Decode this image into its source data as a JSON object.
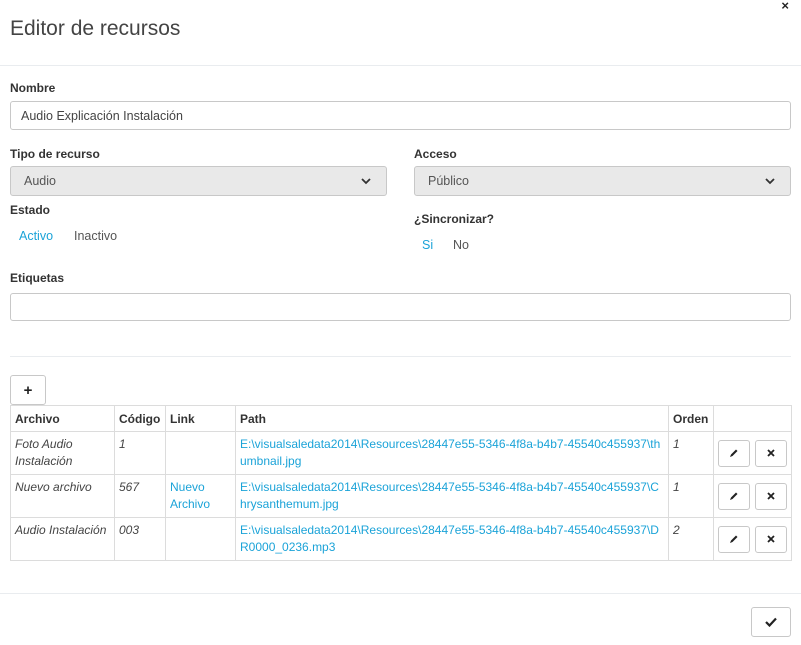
{
  "modal": {
    "title": "Editor de recursos",
    "close_icon": "close-icon"
  },
  "form": {
    "nombre": {
      "label": "Nombre",
      "value": "Audio Explicación Instalación"
    },
    "tipo": {
      "label": "Tipo de recurso",
      "value": "Audio"
    },
    "acceso": {
      "label": "Acceso",
      "value": "Público"
    },
    "estado": {
      "label": "Estado",
      "options": [
        "Activo",
        "Inactivo"
      ],
      "selected": "Activo"
    },
    "sincronizar": {
      "label": "¿Sincronizar?",
      "options": [
        "Si",
        "No"
      ],
      "selected": "Si"
    },
    "etiquetas": {
      "label": "Etiquetas",
      "value": ""
    }
  },
  "table": {
    "add_label": "+",
    "headers": [
      "Archivo",
      "Código",
      "Link",
      "Path",
      "Orden",
      ""
    ],
    "rows": [
      {
        "archivo": "Foto Audio Instalación",
        "codigo": "1",
        "link": "",
        "path": "E:\\visualsaledata2014\\Resources\\28447e55-5346-4f8a-b4b7-45540c455937\\thumbnail.jpg",
        "orden": "1"
      },
      {
        "archivo": "Nuevo archivo",
        "codigo": "567",
        "link": "Nuevo Archivo",
        "path": "E:\\visualsaledata2014\\Resources\\28447e55-5346-4f8a-b4b7-45540c455937\\Chrysanthemum.jpg",
        "orden": "1"
      },
      {
        "archivo": "Audio Instalación",
        "codigo": "003",
        "link": "",
        "path": "E:\\visualsaledata2014\\Resources\\28447e55-5346-4f8a-b4b7-45540c455937\\DR0000_0236.mp3",
        "orden": "2"
      }
    ]
  },
  "colors": {
    "accent": "#1ba3d8",
    "border": "#c8c8c8"
  }
}
